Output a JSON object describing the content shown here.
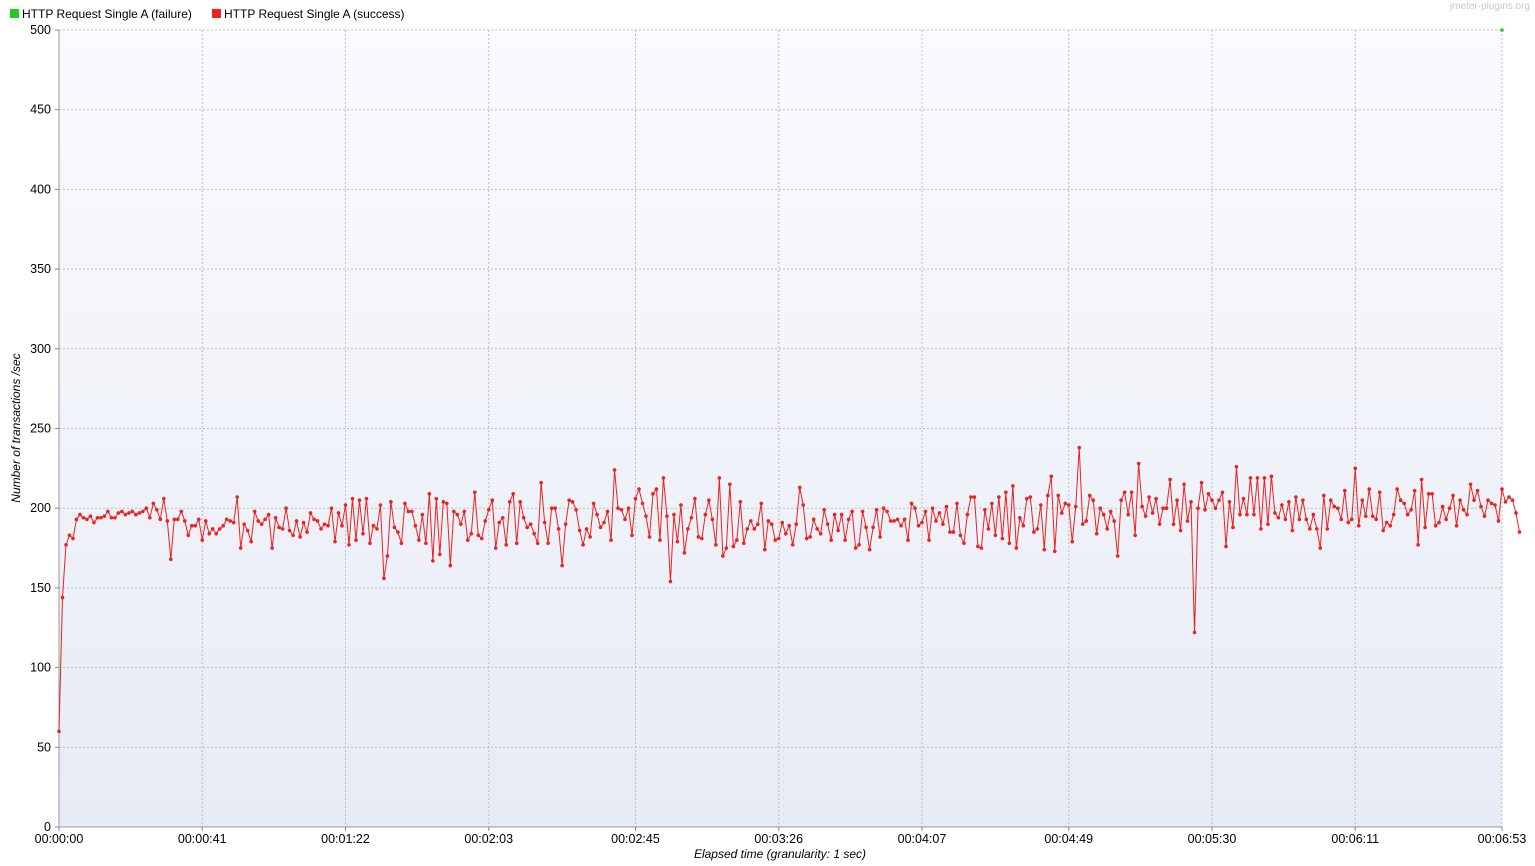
{
  "chart_data": {
    "type": "line",
    "watermark": "jmeter-plugins.org",
    "xlabel": "Elapsed time (granularity: 1 sec)",
    "ylabel": "Number of transactions /sec",
    "ylim": [
      0,
      500
    ],
    "yticks": [
      0,
      50,
      100,
      150,
      200,
      250,
      300,
      350,
      400,
      450,
      500
    ],
    "xlim_seconds": [
      0,
      413
    ],
    "xticks": [
      {
        "seconds": 0,
        "label": "00:00:00"
      },
      {
        "seconds": 41,
        "label": "00:00:41"
      },
      {
        "seconds": 82,
        "label": "00:01:22"
      },
      {
        "seconds": 123,
        "label": "00:02:03"
      },
      {
        "seconds": 165,
        "label": "00:02:45"
      },
      {
        "seconds": 206,
        "label": "00:03:26"
      },
      {
        "seconds": 247,
        "label": "00:04:07"
      },
      {
        "seconds": 289,
        "label": "00:04:49"
      },
      {
        "seconds": 330,
        "label": "00:05:30"
      },
      {
        "seconds": 371,
        "label": "00:06:11"
      },
      {
        "seconds": 413,
        "label": "00:06:53"
      }
    ],
    "grid": true,
    "legend_position": "top-left",
    "series": [
      {
        "name": "HTTP Request Single A (failure)",
        "color": "#22cc22",
        "x": [
          413
        ],
        "values": [
          500
        ]
      },
      {
        "name": "HTTP Request Single A (success)",
        "color": "#ee2020",
        "x_start_seconds": 0,
        "x_step_seconds": 1,
        "values": [
          60,
          144,
          177,
          183,
          181,
          193,
          196,
          194,
          193,
          195,
          191,
          194,
          194,
          195,
          198,
          194,
          194,
          197,
          198,
          196,
          197,
          198,
          196,
          197,
          198,
          200,
          194,
          203,
          199,
          193,
          206,
          192,
          168,
          193,
          193,
          198,
          192,
          183,
          189,
          189,
          193,
          180,
          192,
          184,
          187,
          184,
          187,
          189,
          193,
          192,
          191,
          207,
          175,
          190,
          186,
          179,
          198,
          192,
          190,
          193,
          196,
          175,
          194,
          188,
          187,
          200,
          186,
          183,
          192,
          182,
          191,
          185,
          197,
          193,
          192,
          187,
          190,
          189,
          200,
          179,
          197,
          189,
          202,
          177,
          206,
          180,
          205,
          184,
          206,
          178,
          189,
          187,
          202,
          156,
          170,
          204,
          188,
          185,
          178,
          203,
          198,
          198,
          189,
          180,
          196,
          178,
          209,
          167,
          206,
          171,
          204,
          203,
          164,
          198,
          196,
          190,
          198,
          180,
          184,
          210,
          183,
          181,
          192,
          199,
          205,
          175,
          191,
          194,
          177,
          204,
          209,
          178,
          204,
          194,
          188,
          190,
          184,
          178,
          216,
          191,
          178,
          200,
          200,
          187,
          164,
          190,
          205,
          204,
          199,
          186,
          177,
          187,
          182,
          203,
          196,
          188,
          191,
          198,
          180,
          224,
          200,
          199,
          193,
          200,
          183,
          206,
          212,
          203,
          195,
          182,
          209,
          212,
          180,
          219,
          195,
          154,
          196,
          179,
          202,
          172,
          187,
          194,
          206,
          182,
          181,
          196,
          205,
          193,
          177,
          219,
          170,
          175,
          215,
          176,
          180,
          204,
          178,
          187,
          192,
          187,
          190,
          203,
          174,
          192,
          190,
          180,
          181,
          191,
          184,
          189,
          177,
          190,
          213,
          202,
          181,
          182,
          193,
          187,
          184,
          199,
          190,
          180,
          196,
          186,
          196,
          180,
          193,
          198,
          175,
          177,
          198,
          188,
          174,
          188,
          199,
          182,
          200,
          198,
          192,
          192,
          193,
          189,
          193,
          180,
          203,
          200,
          189,
          191,
          198,
          180,
          200,
          192,
          197,
          190,
          201,
          185,
          185,
          203,
          183,
          178,
          196,
          207,
          207,
          176,
          175,
          199,
          187,
          203,
          183,
          207,
          181,
          210,
          178,
          214,
          175,
          194,
          189,
          206,
          207,
          185,
          187,
          202,
          174,
          208,
          220,
          173,
          208,
          197,
          203,
          202,
          179,
          201,
          238,
          190,
          192,
          208,
          205,
          184,
          200,
          196,
          187,
          198,
          192,
          170,
          205,
          210,
          196,
          210,
          183,
          228,
          201,
          195,
          207,
          197,
          206,
          190,
          200,
          200,
          218,
          190,
          205,
          186,
          215,
          192,
          204,
          122,
          200,
          216,
          199,
          209,
          205,
          200,
          205,
          210,
          176,
          204,
          188,
          226,
          196,
          206,
          196,
          219,
          196,
          219,
          187,
          219,
          190,
          220,
          197,
          194,
          202,
          193,
          204,
          186,
          207,
          193,
          205,
          193,
          187,
          196,
          187,
          175,
          208,
          187,
          205,
          201,
          200,
          193,
          211,
          191,
          193,
          225,
          189,
          205,
          195,
          212,
          195,
          193,
          210,
          186,
          191,
          189,
          196,
          212,
          205,
          203,
          196,
          199,
          211,
          177,
          218,
          188,
          209,
          209,
          189,
          191,
          201,
          193,
          200,
          208,
          189,
          205,
          199,
          196,
          215,
          205,
          211,
          201,
          195,
          205,
          203,
          202,
          192,
          212,
          204,
          207,
          205,
          197,
          185
        ]
      }
    ]
  }
}
